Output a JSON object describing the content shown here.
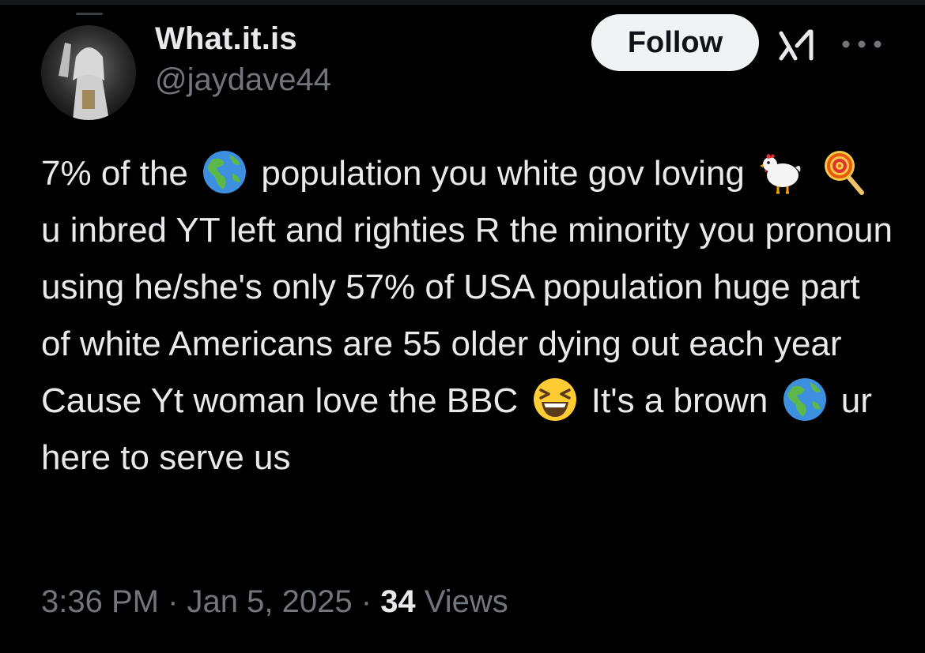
{
  "user": {
    "display_name": "What.it.is",
    "handle": "@jaydave44"
  },
  "actions": {
    "follow_label": "Follow",
    "grok_icon": "grok-icon",
    "more_icon": "more-options-icon"
  },
  "tweet": {
    "segments": [
      {
        "type": "text",
        "value": "7% of the "
      },
      {
        "type": "emoji",
        "icon": "globe-americas-icon"
      },
      {
        "type": "text",
        "value": " population you white gov loving "
      },
      {
        "type": "emoji",
        "icon": "chicken-icon"
      },
      {
        "type": "text",
        "value": " "
      },
      {
        "type": "emoji",
        "icon": "lollipop-icon"
      },
      {
        "type": "text",
        "value": " u inbred YT left and righties R the minority you pronoun using he/she's only 57% of USA population huge part of white Americans are 55 older dying out each year Cause Yt woman love the BBC "
      },
      {
        "type": "emoji",
        "icon": "laughing-face-icon"
      },
      {
        "type": "text",
        "value": " It's a brown "
      },
      {
        "type": "emoji",
        "icon": "globe-americas-icon"
      },
      {
        "type": "text",
        "value": " ur here to serve us"
      }
    ]
  },
  "meta": {
    "time": "3:36 PM",
    "separator": "·",
    "date": "Jan 5, 2025",
    "views_count": "34",
    "views_label": "Views"
  },
  "colors": {
    "background": "#000000",
    "primary_text": "#e7e9ea",
    "secondary_text": "#71767b",
    "follow_button_bg": "#eff3f4",
    "follow_button_text": "#0f1419"
  }
}
